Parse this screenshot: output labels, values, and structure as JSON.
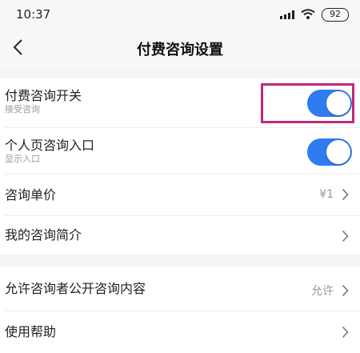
{
  "status_bar": {
    "time": "10:37",
    "battery": "92",
    "signal_icon": "signal-bars-icon",
    "wifi_icon": "wifi-icon"
  },
  "nav": {
    "title": "付费咨询设置",
    "back_icon": "chevron-left-icon"
  },
  "settings": {
    "paid_consult": {
      "label": "付费咨询开关",
      "sublabel": "接受咨询",
      "enabled": true
    },
    "profile_entry": {
      "label": "个人页咨询入口",
      "sublabel": "显示入口",
      "enabled": true
    },
    "unit_price": {
      "label": "咨询单价",
      "value": "¥1"
    },
    "my_intro": {
      "label": "我的咨询简介"
    },
    "allow_public": {
      "label": "允许咨询者公开咨询内容",
      "value": "允许"
    },
    "help": {
      "label": "使用帮助"
    }
  },
  "colors": {
    "toggle_on": "#2f7bef",
    "highlight": "#c0287e",
    "secondary_text": "#9a9a9a"
  }
}
